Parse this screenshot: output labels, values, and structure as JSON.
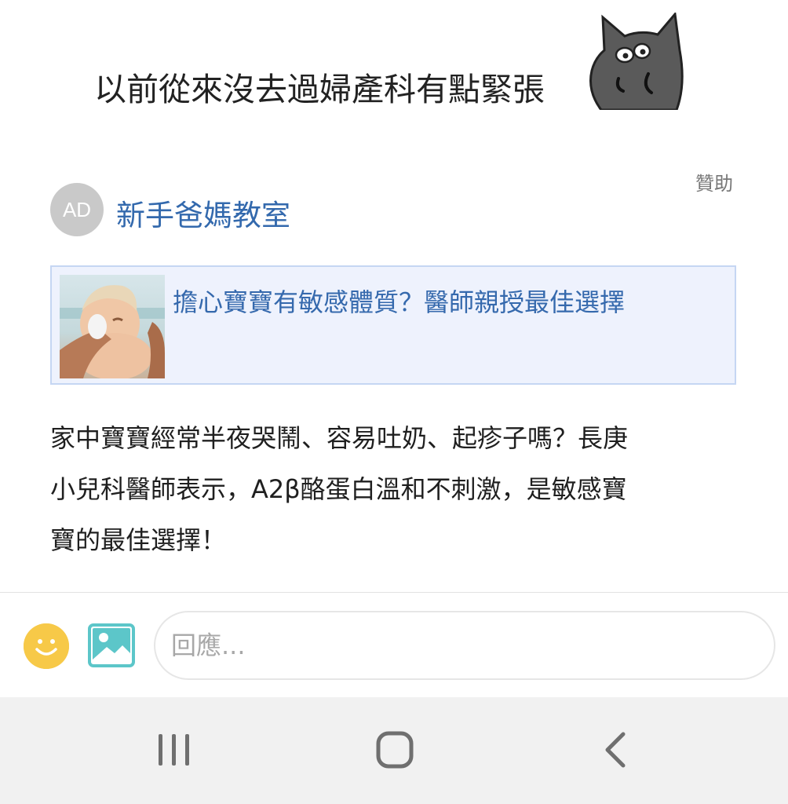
{
  "message": {
    "text": "以前從來沒去過婦產科有點緊張"
  },
  "ad": {
    "sponsored_label": "贊助",
    "avatar_text": "AD",
    "advertiser": "新手爸媽教室",
    "headline": "擔心寶寶有敏感體質？醫師親授最佳選擇",
    "body_lines": [
      "家中寶寶經常半夜哭鬧、容易吐奶、起疹子嗎？長庚",
      "小兒科醫師表示，A2β酪蛋白溫和不刺激，是敏感寶",
      "寶的最佳選擇！"
    ]
  },
  "reply": {
    "placeholder": "回應..."
  },
  "icons": {
    "emoji": "smiley-icon",
    "image": "image-icon",
    "recent": "recent-apps-icon",
    "home": "home-icon",
    "back": "back-icon"
  },
  "colors": {
    "link_blue": "#3569ad",
    "card_bg": "#eef2fd",
    "card_border": "#c5d6f3",
    "emoji_yellow": "#f7c948",
    "image_teal": "#5cc6c9",
    "navbar_bg": "#f1f1f1"
  }
}
